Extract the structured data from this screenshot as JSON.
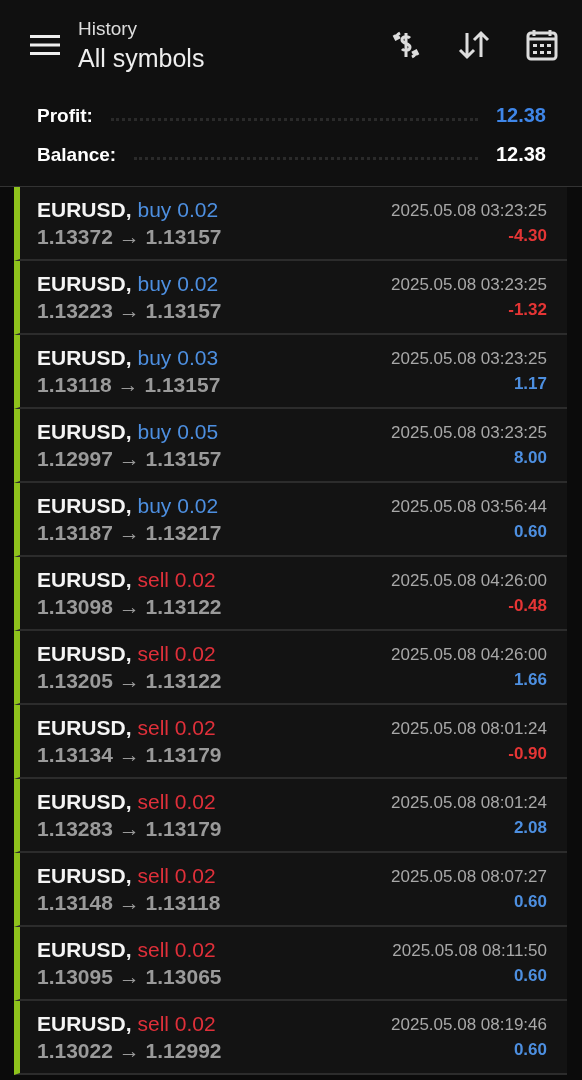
{
  "header": {
    "title": "History",
    "subtitle": "All symbols"
  },
  "summary": [
    {
      "label": "Profit:",
      "value": "12.38",
      "color": "#3f86e8"
    },
    {
      "label": "Balance:",
      "value": "12.38",
      "color": "#ffffff"
    }
  ],
  "deals": [
    {
      "symbol": "EURUSD,",
      "kind": "buy",
      "volume": "buy 0.02",
      "prices": "1.13372 → 1.13157",
      "time": "2025.05.08 03:23:25",
      "profit": "-4.30",
      "color": "#e53535"
    },
    {
      "symbol": "EURUSD,",
      "kind": "buy",
      "volume": "buy 0.02",
      "prices": "1.13223 → 1.13157",
      "time": "2025.05.08 03:23:25",
      "profit": "-1.32",
      "color": "#e53535"
    },
    {
      "symbol": "EURUSD,",
      "kind": "buy",
      "volume": "buy 0.03",
      "prices": "1.13118 → 1.13157",
      "time": "2025.05.08 03:23:25",
      "profit": "1.17",
      "color": "#4d8fe0"
    },
    {
      "symbol": "EURUSD,",
      "kind": "buy",
      "volume": "buy 0.05",
      "prices": "1.12997 → 1.13157",
      "time": "2025.05.08 03:23:25",
      "profit": "8.00",
      "color": "#4d8fe0"
    },
    {
      "symbol": "EURUSD,",
      "kind": "buy",
      "volume": "buy 0.02",
      "prices": "1.13187 → 1.13217",
      "time": "2025.05.08 03:56:44",
      "profit": "0.60",
      "color": "#4d8fe0"
    },
    {
      "symbol": "EURUSD,",
      "kind": "sell",
      "volume": "sell 0.02",
      "prices": "1.13098 → 1.13122",
      "time": "2025.05.08 04:26:00",
      "profit": "-0.48",
      "color": "#e53535"
    },
    {
      "symbol": "EURUSD,",
      "kind": "sell",
      "volume": "sell 0.02",
      "prices": "1.13205 → 1.13122",
      "time": "2025.05.08 04:26:00",
      "profit": "1.66",
      "color": "#4d8fe0"
    },
    {
      "symbol": "EURUSD,",
      "kind": "sell",
      "volume": "sell 0.02",
      "prices": "1.13134 → 1.13179",
      "time": "2025.05.08 08:01:24",
      "profit": "-0.90",
      "color": "#e53535"
    },
    {
      "symbol": "EURUSD,",
      "kind": "sell",
      "volume": "sell 0.02",
      "prices": "1.13283 → 1.13179",
      "time": "2025.05.08 08:01:24",
      "profit": "2.08",
      "color": "#4d8fe0"
    },
    {
      "symbol": "EURUSD,",
      "kind": "sell",
      "volume": "sell 0.02",
      "prices": "1.13148 → 1.13118",
      "time": "2025.05.08 08:07:27",
      "profit": "0.60",
      "color": "#4d8fe0"
    },
    {
      "symbol": "EURUSD,",
      "kind": "sell",
      "volume": "sell 0.02",
      "prices": "1.13095 → 1.13065",
      "time": "2025.05.08 08:11:50",
      "profit": "0.60",
      "color": "#4d8fe0"
    },
    {
      "symbol": "EURUSD,",
      "kind": "sell",
      "volume": "sell 0.02",
      "prices": "1.13022 → 1.12992",
      "time": "2025.05.08 08:19:46",
      "profit": "0.60",
      "color": "#4d8fe0"
    }
  ]
}
